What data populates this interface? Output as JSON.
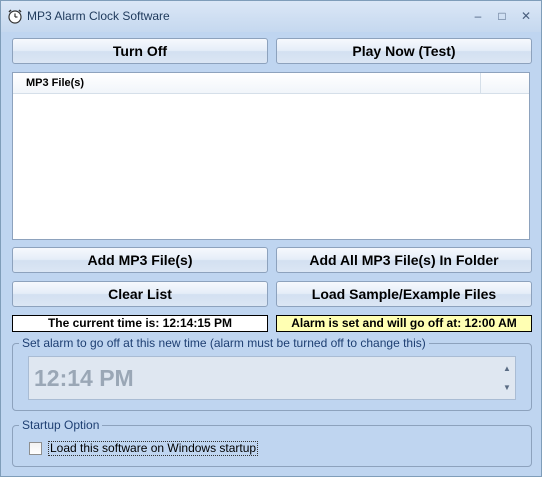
{
  "window": {
    "title": "MP3 Alarm Clock Software",
    "icon": "alarm-clock-icon",
    "minimize_glyph": "–",
    "maximize_glyph": "□",
    "close_glyph": "✕"
  },
  "buttons": {
    "turn_off": "Turn Off",
    "play_now": "Play Now (Test)",
    "add_mp3": "Add MP3 File(s)",
    "add_all_folder": "Add All MP3 File(s) In Folder",
    "clear_list": "Clear List",
    "load_samples": "Load Sample/Example Files"
  },
  "file_list": {
    "columns": [
      "MP3 File(s)"
    ],
    "rows": []
  },
  "status": {
    "current_time": "The current time is: 12:14:15 PM",
    "alarm": "Alarm is set and will go off at: 12:00 AM"
  },
  "alarm_group": {
    "label": "Set alarm to go off at this new time (alarm must be turned off to change this)",
    "time_value": "12:14 PM",
    "enabled": false,
    "spin_up_glyph": "▲",
    "spin_down_glyph": "▼"
  },
  "startup_group": {
    "label": "Startup Option",
    "checkbox_label": "Load this software on Windows startup",
    "checked": false
  },
  "colors": {
    "window_bg": "#bfd5f0",
    "alarm_status_bg": "#ffffb3"
  }
}
